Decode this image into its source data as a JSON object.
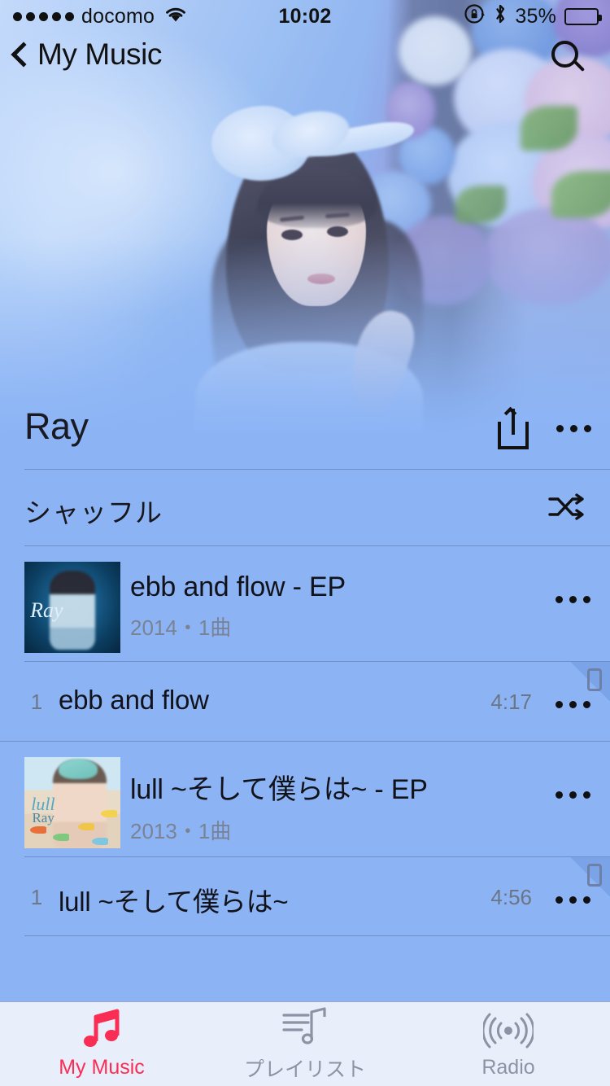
{
  "status_bar": {
    "signal_dots": 5,
    "carrier": "docomo",
    "wifi_icon": "wifi-icon",
    "time": "10:02",
    "rotation_lock_icon": "rotation-lock-icon",
    "bluetooth_icon": "bluetooth-icon",
    "battery_percent": "35%",
    "battery_level": 35
  },
  "nav_bar": {
    "back_label": "My Music",
    "back_icon": "chevron-left-icon",
    "search_icon": "search-icon"
  },
  "artist": {
    "name": "Ray",
    "share_icon": "share-icon",
    "more_icon": "ellipsis-icon"
  },
  "shuffle": {
    "label": "シャッフル",
    "icon": "shuffle-icon"
  },
  "albums": [
    {
      "title": "ebb and flow - EP",
      "subtitle": "2014・1曲",
      "year": "2014",
      "track_count": "1曲",
      "artwork_name": "album-art-ebb-and-flow",
      "artwork_caption": "Ray",
      "more_icon": "ellipsis-icon",
      "tracks": [
        {
          "number": "1",
          "title": "ebb and flow",
          "duration": "4:17",
          "downloaded_icon": "device-downloaded-icon",
          "more_icon": "ellipsis-icon"
        }
      ]
    },
    {
      "title": "lull ~そして僕らは~ - EP",
      "subtitle": "2013・1曲",
      "year": "2013",
      "track_count": "1曲",
      "artwork_name": "album-art-lull",
      "artwork_caption": "lull",
      "artwork_caption2": "Ray",
      "more_icon": "ellipsis-icon",
      "tracks": [
        {
          "number": "1",
          "title": "lull ~そして僕らは~",
          "duration": "4:56",
          "downloaded_icon": "device-downloaded-icon",
          "more_icon": "ellipsis-icon"
        }
      ]
    }
  ],
  "tab_bar": {
    "tabs": [
      {
        "label": "My Music",
        "icon": "music-note-icon",
        "active": true
      },
      {
        "label": "プレイリスト",
        "icon": "playlist-icon",
        "active": false
      },
      {
        "label": "Radio",
        "icon": "radio-waves-icon",
        "active": false
      }
    ]
  },
  "colors": {
    "background": "#8CB4F5",
    "accent": "#FA2D55",
    "tab_bar_bg": "#E9EFFA",
    "secondary_text": "#7A8296",
    "primary_text": "#12121A"
  }
}
